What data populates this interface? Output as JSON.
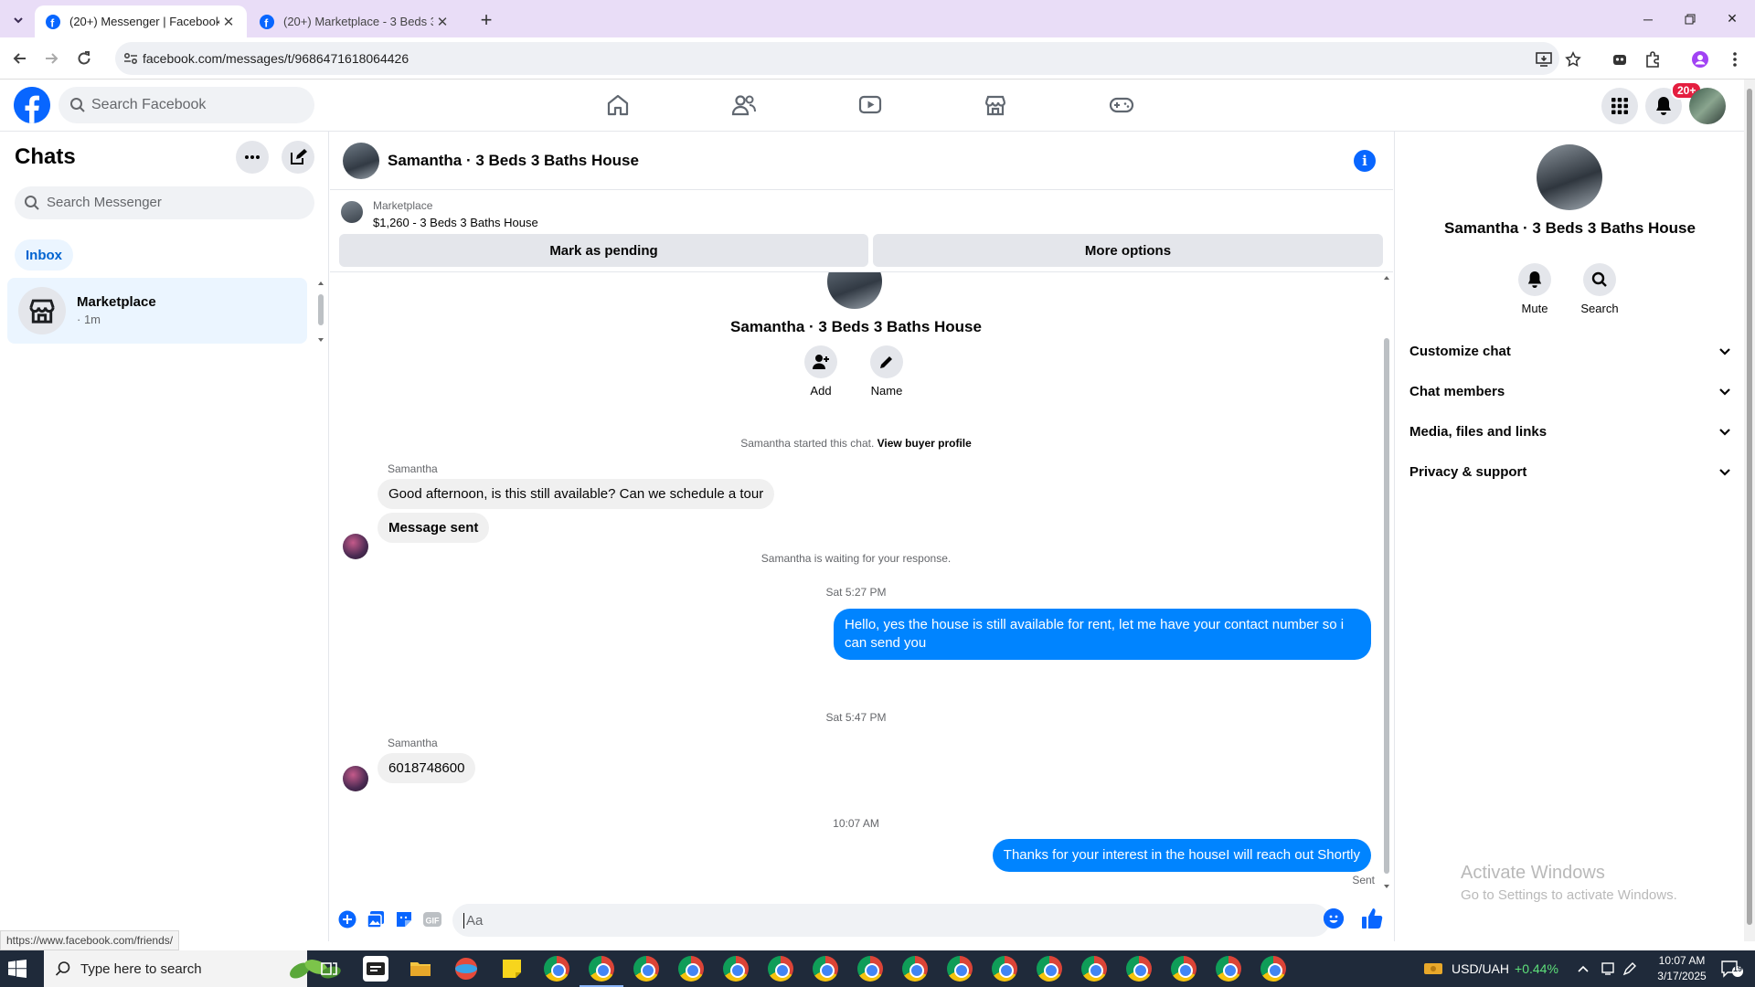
{
  "browser": {
    "tabs": [
      {
        "title": "(20+) Messenger | Facebook",
        "active": true
      },
      {
        "title": "(20+) Marketplace - 3 Beds 3 B",
        "active": false
      }
    ],
    "url": "facebook.com/messages/t/9686471618064426",
    "status_url": "https://www.facebook.com/friends/"
  },
  "fb": {
    "search_placeholder": "Search Facebook",
    "notification_count": "20+"
  },
  "chats": {
    "title": "Chats",
    "search_placeholder": "Search Messenger",
    "inbox_label": "Inbox",
    "items": [
      {
        "name": "Marketplace",
        "sub": "· 1m"
      }
    ]
  },
  "conversation": {
    "title": "Samantha · 3 Beds 3 Baths House",
    "listing": {
      "source": "Marketplace",
      "price_title": "$1,260 - 3 Beds 3 Baths House",
      "mark_pending": "Mark as pending",
      "more_options": "More options"
    },
    "thread_name": "Samantha · 3 Beds 3 Baths House",
    "actions": {
      "add": "Add",
      "name": "Name"
    },
    "started": "Samantha started this chat.",
    "view_buyer": "View buyer profile",
    "messages": {
      "sender1": "Samantha",
      "m1": "Good afternoon, is this still available? Can we schedule a tour",
      "m2": "Message sent",
      "waiting": "Samantha is waiting for your response.",
      "time1": "Sat 5:27 PM",
      "m3": "Hello, yes the house is still available for rent, let me have your contact number so i can send you",
      "time2": "Sat 5:47 PM",
      "sender2": "Samantha",
      "m4": "6018748600",
      "time3": "10:07 AM",
      "m5": "Thanks for your interest in the houseI will reach out Shortly",
      "sent": "Sent"
    },
    "composer_placeholder": "Aa"
  },
  "info_panel": {
    "name": "Samantha · 3 Beds 3 Baths House",
    "mute": "Mute",
    "search": "Search",
    "sections": [
      "Customize chat",
      "Chat members",
      "Media, files and links",
      "Privacy & support"
    ]
  },
  "watermark": {
    "line1": "Activate Windows",
    "line2": "Go to Settings to activate Windows."
  },
  "taskbar": {
    "search_placeholder": "Type here to search",
    "currency": "USD/UAH",
    "currency_change": "+0.44%",
    "time": "10:07 AM",
    "date": "3/17/2025",
    "notifications": "19"
  },
  "colors": {
    "fb_blue": "#0866ff",
    "bubble_out": "#0084ff",
    "tab_strip": "#e9ddf7",
    "taskbar": "#1f2a3a"
  }
}
